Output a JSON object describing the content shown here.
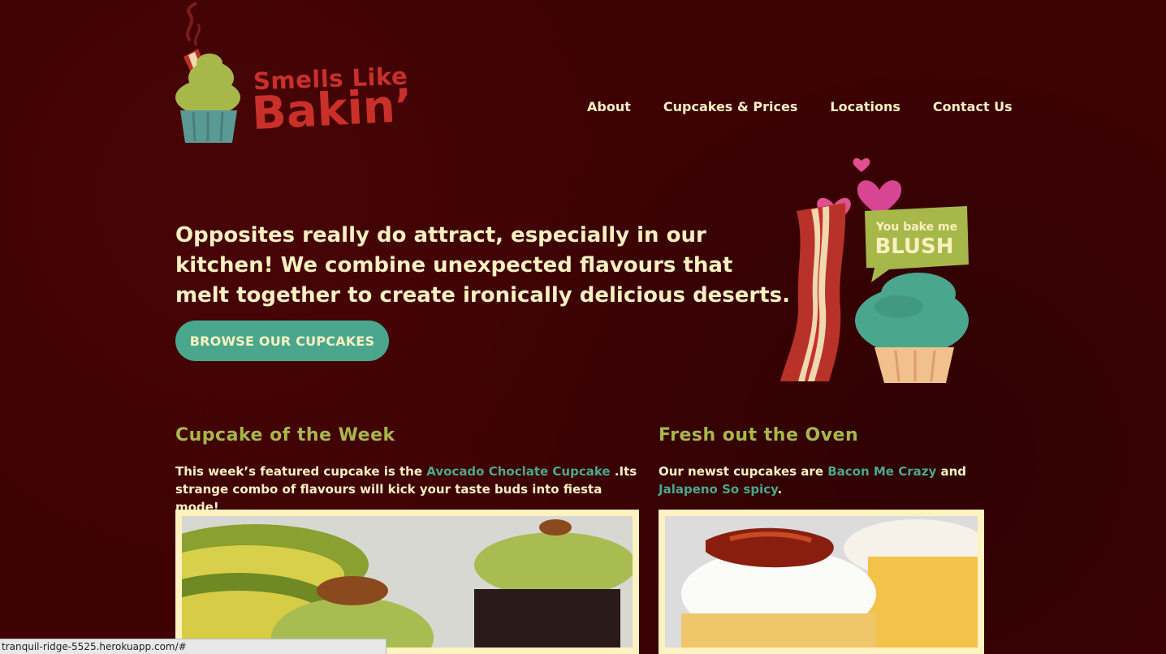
{
  "header": {
    "logo_line_1": "Smells Like",
    "logo_line_2": "Bakin’",
    "nav": [
      {
        "label": "About"
      },
      {
        "label": "Cupcakes & Prices"
      },
      {
        "label": "Locations"
      },
      {
        "label": "Contact Us"
      }
    ]
  },
  "hero": {
    "text": "Opposites really do attract, especially in our kitchen! We combine unexpected flavours that melt together to create ironically delicious deserts.",
    "button": "BROWSE OUR CUPCAKES",
    "badge_line_1": "You bake me",
    "badge_line_2": "BLUSH"
  },
  "week": {
    "title": "Cupcake of the Week",
    "text_before": "This week’s featured cupcake is the ",
    "link": "Avocado Choclate Cupcake",
    "text_after": " .Its strange combo of flavours will kick your taste buds into fiesta mode!"
  },
  "fresh": {
    "title": "Fresh out the Oven",
    "text_before": "Our newst cupcakes are ",
    "link1": "Bacon Me Crazy",
    "text_mid": " and ",
    "link2": "Jalapeno So spicy",
    "text_after": "."
  },
  "status_url": "tranquil-ridge-5525.herokuapp.com/#",
  "colors": {
    "background": "#3e0204",
    "cream": "#fbf0c0",
    "teal": "#4aa78e",
    "olive": "#a6b84a",
    "red": "#c9302a",
    "pink": "#e0508f"
  }
}
